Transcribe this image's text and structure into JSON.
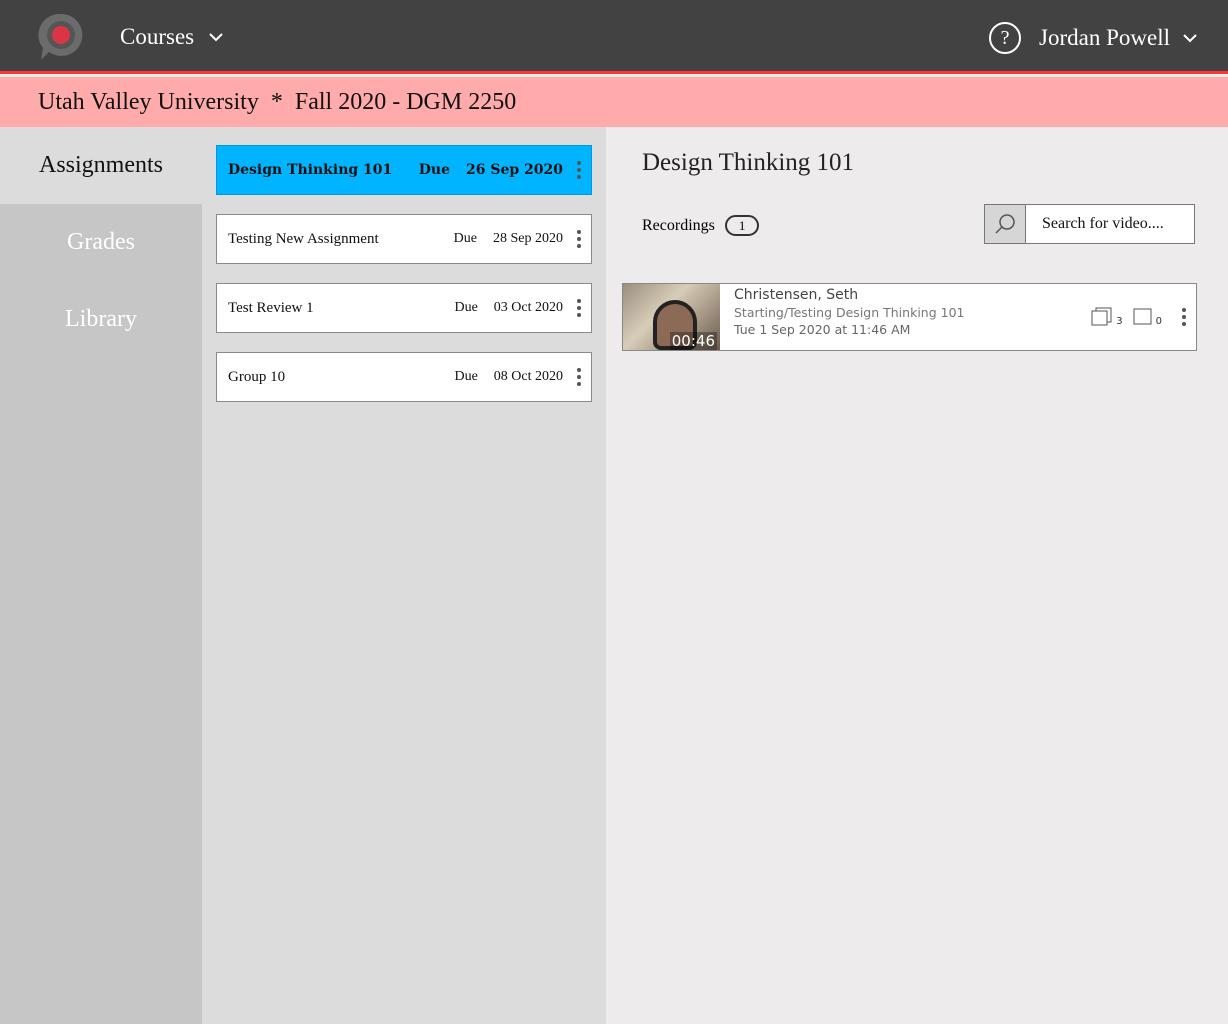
{
  "header": {
    "courses_label": "Courses",
    "user_name": "Jordan Powell",
    "help_label": "?"
  },
  "breadcrumb": {
    "school": "Utah Valley University",
    "separator": "*",
    "course": "Fall 2020 - DGM 2250"
  },
  "nav": {
    "items": [
      {
        "label": "Assignments"
      },
      {
        "label": "Grades"
      },
      {
        "label": "Library"
      }
    ]
  },
  "assignments": [
    {
      "title": "Design Thinking 101",
      "due_label": "Due",
      "date": "26 Sep 2020"
    },
    {
      "title": "Testing New Assignment",
      "due_label": "Due",
      "date": "28 Sep 2020"
    },
    {
      "title": "Test Review 1",
      "due_label": "Due",
      "date": "03 Oct 2020"
    },
    {
      "title": "Group 10",
      "due_label": "Due",
      "date": "08 Oct 2020"
    }
  ],
  "main": {
    "title": "Design Thinking 101",
    "recordings_label": "Recordings",
    "recordings_count": "1",
    "search_placeholder": "Search for video....",
    "videos": [
      {
        "author": "Christensen, Seth",
        "subtitle": "Starting/Testing Design Thinking 101",
        "date": "Tue 1 Sep 2020 at 11:46 AM",
        "duration": "00:46",
        "comments_a": "3",
        "comments_b": "0"
      }
    ]
  },
  "colors": {
    "accent": "#00b4ff",
    "header": "#424242",
    "breadcrumb": "#ffabab",
    "stripe": "#ff3333"
  }
}
